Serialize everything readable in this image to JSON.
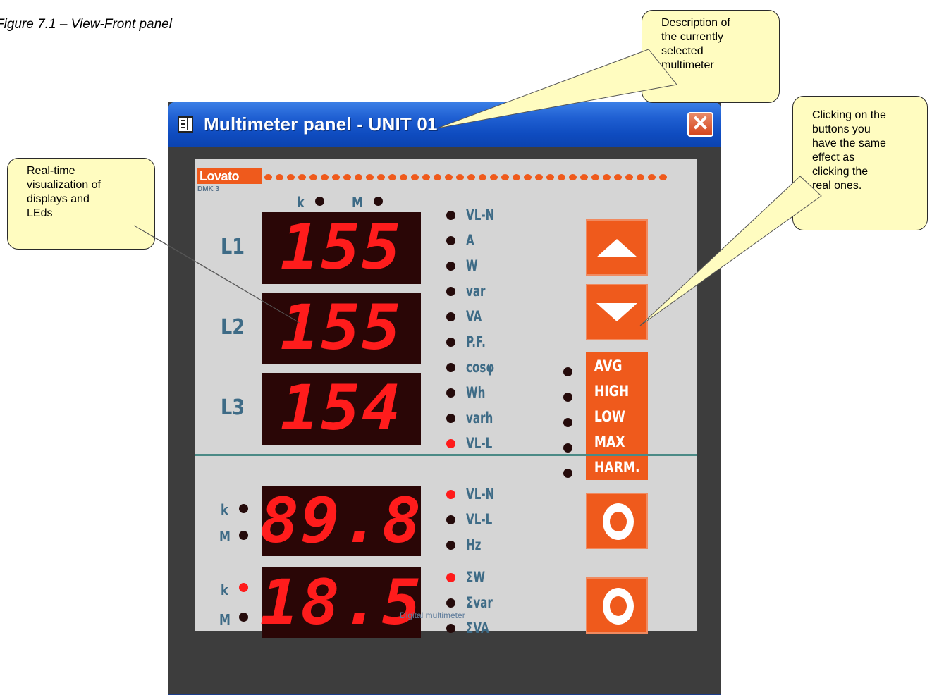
{
  "figure_caption": "Figure  7.1 – View-Front panel",
  "callouts": {
    "description": [
      "Description of",
      "the currently",
      "selected",
      "multimeter"
    ],
    "realtime": [
      "Real-time",
      "visualization of",
      "displays and",
      "LEds"
    ],
    "buttons": [
      "Clicking on the",
      "buttons you",
      "have the same",
      "effect as",
      "clicking the",
      "real ones."
    ]
  },
  "window": {
    "title": "Multimeter panel - UNIT 01",
    "close_label": "✕"
  },
  "panel": {
    "brand": "Lovato",
    "model": "DMK 3",
    "top_prefixes": [
      "k",
      "M"
    ],
    "line_labels": [
      "L1",
      "L2",
      "L3"
    ],
    "line_values": [
      "155",
      "155",
      "154"
    ],
    "units": [
      "VL-N",
      "A",
      "W",
      "var",
      "VA",
      "P.F.",
      "cosφ",
      "Wh",
      "varh",
      "VL-L"
    ],
    "units_active": [
      false,
      false,
      false,
      false,
      false,
      false,
      false,
      false,
      false,
      true
    ],
    "modes": [
      "AVG",
      "HIGH",
      "LOW",
      "MAX",
      "HARM."
    ],
    "bottom1": {
      "prefixes": [
        "k",
        "M"
      ],
      "value": "89.8",
      "units": [
        "VL-N",
        "VL-L",
        "Hz"
      ],
      "units_active": [
        true,
        false,
        false
      ],
      "prefix_active": [
        false,
        false
      ]
    },
    "bottom2": {
      "prefixes": [
        "k",
        "M"
      ],
      "value": "18.5",
      "units": [
        "ΣW",
        "Σvar",
        "ΣVA"
      ],
      "units_active": [
        true,
        false,
        false
      ],
      "prefix_active": [
        true,
        false
      ]
    },
    "footer": "Digital multimeter"
  },
  "colors": {
    "accent": "#ef5a1c",
    "led_on": "#ff1b1b",
    "label": "#3e6b86",
    "titlebar": "#1f5fd2"
  },
  "icons": {
    "up": "triangle-up-icon",
    "down": "triangle-down-icon",
    "refresh": "refresh-icon",
    "app": "panel-window-icon"
  }
}
